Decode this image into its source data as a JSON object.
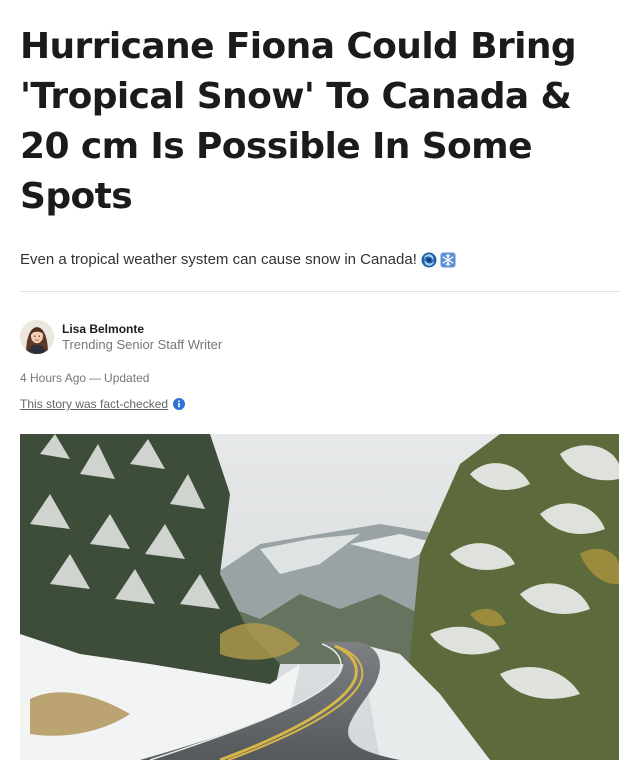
{
  "article": {
    "headline": "Hurricane Fiona Could Bring 'Tropical Snow' To Canada & 20 cm Is Possible In Some Spots",
    "dek": "Even a tropical weather system can cause snow in Canada!",
    "dek_icons": [
      "cyclone-icon",
      "snowflake-icon"
    ],
    "author": {
      "name": "Lisa Belmonte",
      "role": "Trending Senior Staff Writer"
    },
    "published": "4 Hours Ago",
    "separator": "—",
    "updated": "Updated",
    "fact_check": "This story was fact-checked",
    "fact_check_icon": "info-icon"
  },
  "colors": {
    "headline": "#1b1b1b",
    "muted": "#777777",
    "info_blue": "#2f6fd6",
    "divider": "#e2e2e2"
  }
}
